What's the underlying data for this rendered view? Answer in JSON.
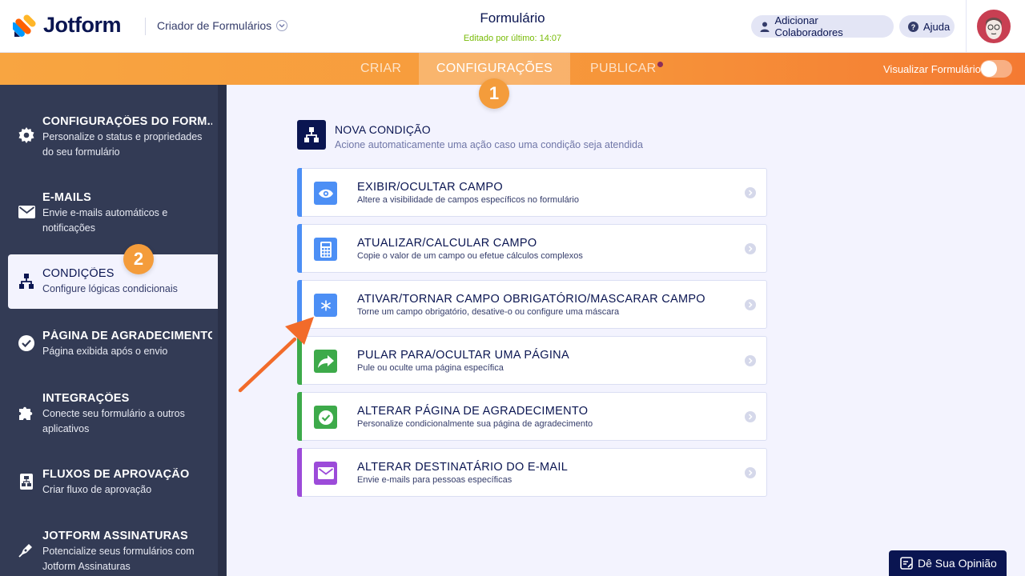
{
  "header": {
    "logo_text": "Jotform",
    "builder_label": "Criador de Formulários",
    "form_title": "Formulário",
    "last_edited": "Editado por último: 14:07",
    "add_collaborators": "Adicionar Colaboradores",
    "help": "Ajuda"
  },
  "tabs": {
    "criar": "CRIAR",
    "configuracoes": "CONFIGURAÇÕES",
    "publicar": "PUBLICAR",
    "preview_label": "Visualizar Formulário"
  },
  "badges": {
    "one": "1",
    "two": "2"
  },
  "sidebar": {
    "items": [
      {
        "title": "CONFIGURAÇÕES DO FORM...",
        "desc": "Personalize o status e propriedades do seu formulário",
        "icon": "gear-icon"
      },
      {
        "title": "E-MAILS",
        "desc": "Envie e-mails automáticos e notificações",
        "icon": "envelope-icon"
      },
      {
        "title": "CONDIÇÕES",
        "desc": "Configure lógicas condicionais",
        "icon": "hierarchy-icon"
      },
      {
        "title": "PÁGINA DE AGRADECIMENTO",
        "desc": "Página exibida após o envio",
        "icon": "check-circle-icon"
      },
      {
        "title": "INTEGRAÇÕES",
        "desc": "Conecte seu formulário a outros aplicativos",
        "icon": "puzzle-icon"
      },
      {
        "title": "FLUXOS DE APROVAÇÃO",
        "desc": "Criar fluxo de aprovação",
        "icon": "approval-flow-icon"
      },
      {
        "title": "JOTFORM ASSINATURAS",
        "desc": "Potencialize seus formulários com Jotform Assinaturas",
        "icon": "pen-icon"
      }
    ]
  },
  "main": {
    "new_condition_title": "NOVA CONDIÇÃO",
    "new_condition_sub": "Acione automaticamente uma ação caso uma condição seja atendida",
    "cards": [
      {
        "title": "EXIBIR/OCULTAR CAMPO",
        "desc": "Altere a visibilidade de campos específicos no formulário",
        "color": "#4c8ff5",
        "icon": "eye-icon"
      },
      {
        "title": "ATUALIZAR/CALCULAR CAMPO",
        "desc": "Copie o valor de um campo ou efetue cálculos complexos",
        "color": "#4c8ff5",
        "icon": "calculator-icon"
      },
      {
        "title": "ATIVAR/TORNAR CAMPO OBRIGATÓRIO/MASCARAR CAMPO",
        "desc": "Torne um campo obrigatório, desative-o ou configure uma máscara",
        "color": "#4c8ff5",
        "icon": "asterisk-icon"
      },
      {
        "title": "PULAR PARA/OCULTAR UMA PÁGINA",
        "desc": "Pule ou oculte uma página específica",
        "color": "#3daa4a",
        "icon": "share-arrow-icon"
      },
      {
        "title": "ALTERAR PÁGINA DE AGRADECIMENTO",
        "desc": "Personalize condicionalmente sua página de agradecimento",
        "color": "#3daa4a",
        "icon": "check-circle-icon"
      },
      {
        "title": "ALTERAR DESTINATÁRIO DO E-MAIL",
        "desc": "Envie e-mails para pessoas específicas",
        "color": "#9c4bd9",
        "icon": "envelope-icon"
      }
    ]
  },
  "feedback": {
    "label": "Dê Sua Opinião"
  },
  "colors": {
    "accent_orange": "#f79b3c",
    "navy": "#0a1551",
    "sidebar_bg": "#333b55"
  }
}
